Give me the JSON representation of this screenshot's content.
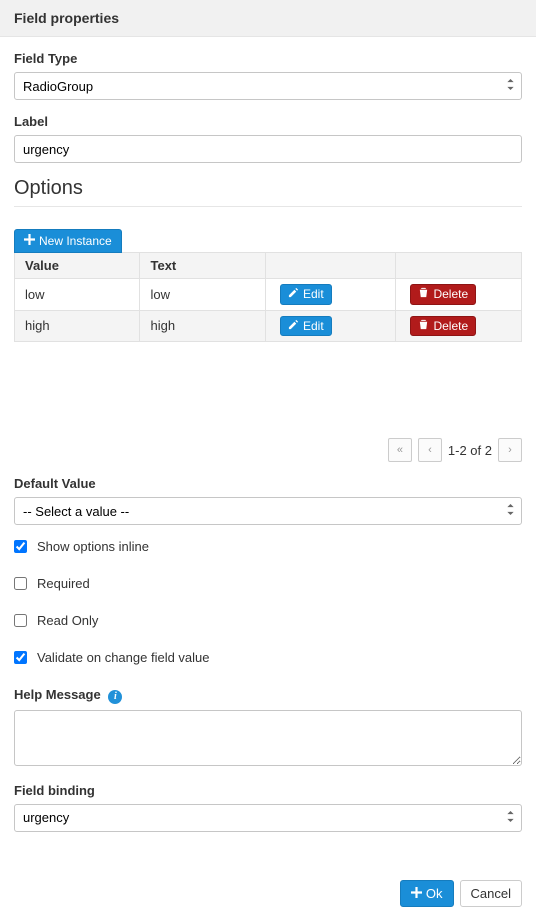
{
  "header": {
    "title": "Field properties"
  },
  "field_type": {
    "label": "Field Type",
    "value": "RadioGroup"
  },
  "label": {
    "label": "Label",
    "value": "urgency"
  },
  "options": {
    "title": "Options",
    "new_instance_label": "New Instance",
    "columns": {
      "value": "Value",
      "text": "Text"
    },
    "rows": [
      {
        "value": "low",
        "text": "low"
      },
      {
        "value": "high",
        "text": "high"
      }
    ],
    "edit_label": "Edit",
    "delete_label": "Delete",
    "pager": {
      "text": "1-2 of 2"
    }
  },
  "default_value": {
    "label": "Default Value",
    "placeholder": "-- Select a value --"
  },
  "checks": {
    "show_inline": {
      "label": "Show options inline",
      "checked": true
    },
    "required": {
      "label": "Required",
      "checked": false
    },
    "read_only": {
      "label": "Read Only",
      "checked": false
    },
    "validate": {
      "label": "Validate on change field value",
      "checked": true
    }
  },
  "help_message": {
    "label": "Help Message",
    "value": ""
  },
  "field_binding": {
    "label": "Field binding",
    "value": "urgency"
  },
  "footer": {
    "ok": "Ok",
    "cancel": "Cancel"
  }
}
